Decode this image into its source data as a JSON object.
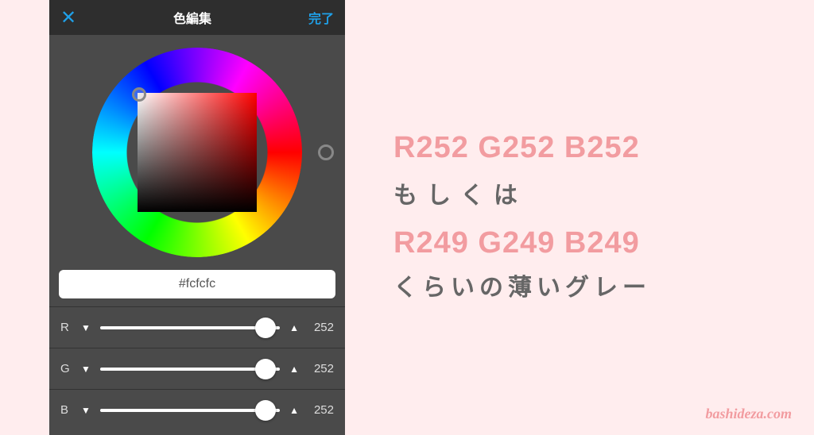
{
  "header": {
    "close_glyph": "✕",
    "title": "色編集",
    "done_label": "完了"
  },
  "hex_value": "#fcfcfc",
  "sliders": {
    "r": {
      "label": "R",
      "value": "252"
    },
    "g": {
      "label": "G",
      "value": "252"
    },
    "b": {
      "label": "B",
      "value": "252"
    }
  },
  "triangles": {
    "left": "▼",
    "right": "▲"
  },
  "annotation": {
    "line1": "R252 G252 B252",
    "line2": "もしくは",
    "line3": "R249 G249 B249",
    "line4": "くらいの薄いグレー"
  },
  "watermark": "bashideza.com"
}
